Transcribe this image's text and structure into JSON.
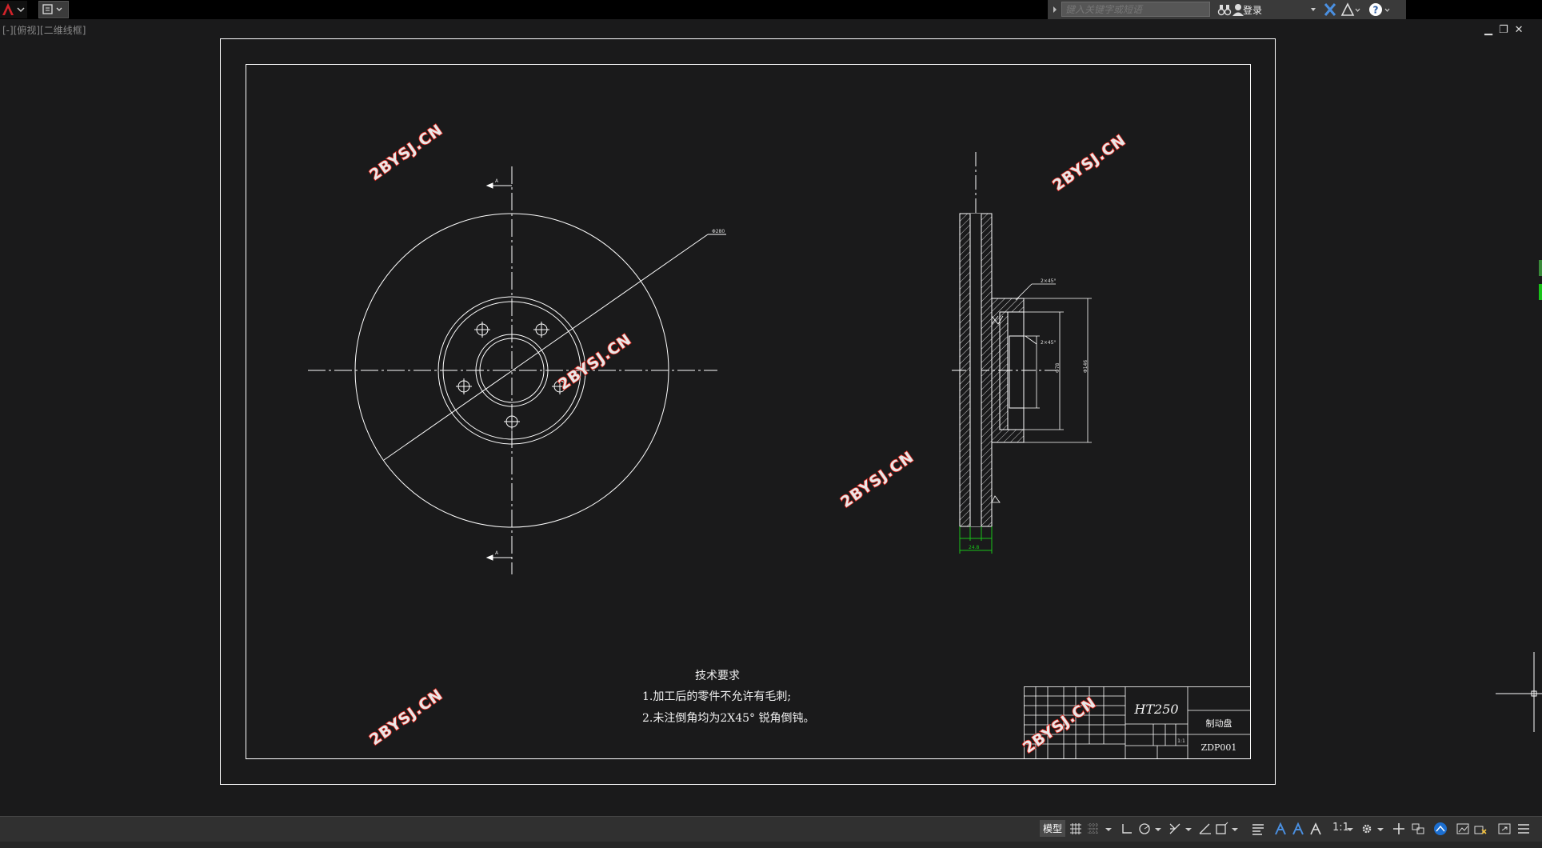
{
  "search": {
    "placeholder": "键入关键字或短语"
  },
  "user": {
    "login_label": "登录"
  },
  "viewport": {
    "label": "[-][俯视][二维线框]"
  },
  "drawing": {
    "outer_diameter_label": "Φ280",
    "section_label": "A",
    "chamfer_label_1": "2×45°",
    "chamfer_label_2": "2×45°",
    "dim_bottom": "24.8",
    "dim_d1": "Φ146",
    "dim_d2": "Φ78",
    "tech_req_title": "技术要求",
    "tech_req_1": "1.加工后的零件不允许有毛刺;",
    "tech_req_2": "2.未注倒角均为2X45° 锐角倒钝。",
    "title_block": {
      "material": "HT250",
      "part_name": "制动盘",
      "drawing_no": "ZDP001",
      "scale": "1:1"
    }
  },
  "watermark": {
    "text": "2BYSJ.CN"
  },
  "status_bar": {
    "model_tab": "模型",
    "scale_label": "1:1"
  },
  "colors": {
    "background": "#1a1a1b",
    "line": "#ffffff",
    "accent_green": "#19c219",
    "watermark_red": "#e1251b"
  }
}
